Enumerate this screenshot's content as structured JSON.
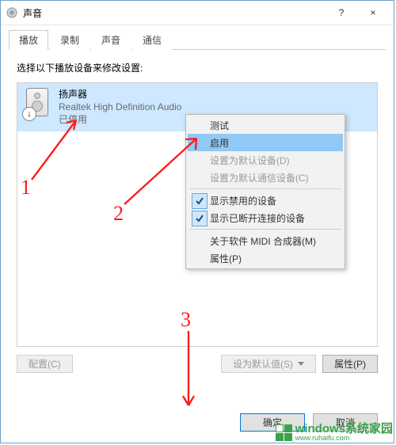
{
  "window": {
    "title": "声音",
    "close_label": "×",
    "help_label": "?"
  },
  "tabs": [
    {
      "label": "播放",
      "active": true
    },
    {
      "label": "录制",
      "active": false
    },
    {
      "label": "声音",
      "active": false
    },
    {
      "label": "通信",
      "active": false
    }
  ],
  "instruction": "选择以下播放设备来修改设置:",
  "device": {
    "name": "扬声器",
    "desc": "Realtek High Definition Audio",
    "status": "已停用",
    "badge": "↓"
  },
  "context_menu": {
    "items": [
      {
        "label": "测试",
        "kind": "item"
      },
      {
        "label": "启用",
        "kind": "item",
        "highlight": true
      },
      {
        "label": "设置为默认设备(D)",
        "kind": "item",
        "disabled": true
      },
      {
        "label": "设置为默认通信设备(C)",
        "kind": "item",
        "disabled": true
      },
      {
        "kind": "sep"
      },
      {
        "label": "显示禁用的设备",
        "kind": "item",
        "checked": true
      },
      {
        "label": "显示已断开连接的设备",
        "kind": "item",
        "checked": true
      },
      {
        "kind": "sep"
      },
      {
        "label": "关于软件 MIDI 合成器(M)",
        "kind": "item"
      },
      {
        "label": "属性(P)",
        "kind": "item"
      }
    ]
  },
  "bottom_buttons": {
    "configure": "配置(C)",
    "set_default": "设为默认值(S)",
    "properties": "属性(P)"
  },
  "dialog_buttons": {
    "ok": "确定",
    "cancel": "取消"
  },
  "annotations": {
    "one": "1",
    "two": "2",
    "three": "3"
  },
  "watermark": {
    "line1": "windows系统家园",
    "line2": "www.ruhaifu.com"
  }
}
